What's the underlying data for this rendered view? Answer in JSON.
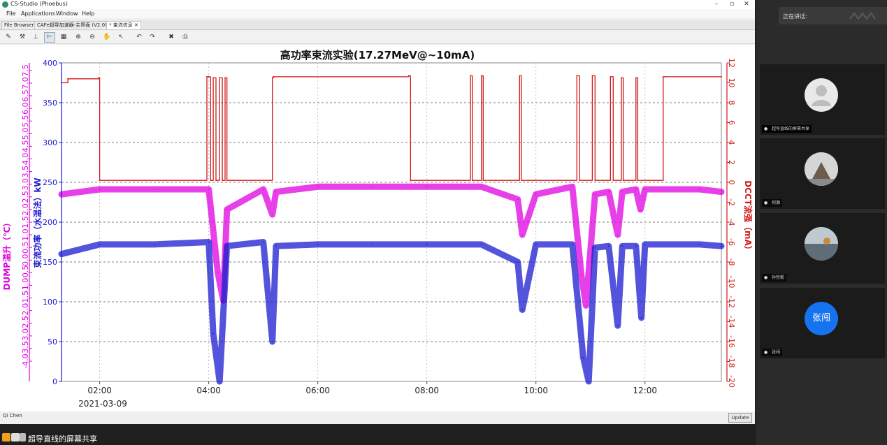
{
  "window": {
    "title": "CS-Studio (Phoebus)"
  },
  "menu": [
    "File",
    "Applications",
    "Window",
    "Help"
  ],
  "tabs": [
    {
      "label": "File Browser",
      "active": false
    },
    {
      "label": "CAFe超导加速器-主界面 (V2.0)",
      "active": false
    },
    {
      "label": "* 束流信息 ✕",
      "active": true
    }
  ],
  "toolbar_icons": [
    "tool-icon",
    "tool-icon",
    "tool-icon",
    "crosshair-icon",
    "axis-icon",
    "zoom-in-icon",
    "zoom-out-icon",
    "pan-icon",
    "pointer-icon",
    "undo-icon",
    "redo-icon",
    "export-icon",
    "print-icon"
  ],
  "chart_data": {
    "type": "line",
    "title": "高功率束流实验(17.27MeV@~10mA)",
    "date_label": "2021-03-09",
    "xlim": [
      "01:18",
      "13:24"
    ],
    "xticks": [
      "02:00",
      "04:00",
      "06:00",
      "08:00",
      "10:00",
      "12:00"
    ],
    "y_axes": [
      {
        "id": "dump",
        "label": "DUMP温升（℃）",
        "color": "#e000e0",
        "ylim": [
          -4.8,
          7.8
        ],
        "ticks": [
          -4.0,
          -3.5,
          -3.0,
          -2.5,
          -2.0,
          -1.5,
          -1.0,
          -0.5,
          0.0,
          0.5,
          1.0,
          1.5,
          2.0,
          2.5,
          3.0,
          3.5,
          4.0,
          4.5,
          5.0,
          5.5,
          6.0,
          6.5,
          7.0,
          7.5
        ]
      },
      {
        "id": "power",
        "label": "束流功率（水温法）kW",
        "color": "#1a1ad0",
        "ylim": [
          0,
          400
        ],
        "ticks": [
          0,
          50,
          100,
          150,
          200,
          250,
          300,
          350,
          400
        ]
      },
      {
        "id": "dcct",
        "label": "DCCT流强（mA）",
        "color": "#d01818",
        "ylim": [
          -20,
          12
        ],
        "ticks": [
          12,
          10,
          8,
          6,
          4,
          2,
          0,
          -2,
          -4,
          -6,
          -8,
          -10,
          -12,
          -14,
          -16,
          -18,
          -20
        ]
      }
    ],
    "series": [
      {
        "axis": "dcct",
        "color": "#d01818",
        "x": [
          "01:18",
          "01:25",
          "01:59",
          "02:00",
          "03:58",
          "04:00",
          "04:02",
          "04:05",
          "04:08",
          "04:12",
          "04:15",
          "04:18",
          "04:20",
          "05:08",
          "05:10",
          "05:11",
          "07:40",
          "07:42",
          "08:48",
          "08:50",
          "09:00",
          "09:02",
          "09:42",
          "09:44",
          "10:45",
          "10:48",
          "11:02",
          "11:05",
          "11:22",
          "11:25",
          "11:34",
          "11:36",
          "11:50",
          "11:52",
          "12:20",
          "12:22",
          "13:24"
        ],
        "values": [
          10.0,
          10.4,
          10.5,
          0.2,
          10.6,
          10.6,
          0.2,
          10.5,
          0.2,
          10.5,
          0.2,
          10.5,
          0.2,
          0.2,
          10.5,
          10.6,
          10.7,
          0.2,
          10.7,
          0.2,
          10.7,
          0.2,
          10.7,
          0.2,
          10.7,
          0.2,
          10.7,
          0.2,
          10.6,
          0.2,
          10.5,
          0.2,
          10.5,
          0.2,
          10.6,
          10.6,
          10.6
        ]
      },
      {
        "axis": "dump",
        "color": "#e000e0",
        "x": [
          "01:18",
          "02:00",
          "03:00",
          "04:00",
          "04:10",
          "04:16",
          "04:20",
          "05:00",
          "05:10",
          "05:14",
          "06:00",
          "07:00",
          "08:00",
          "09:00",
          "09:40",
          "09:45",
          "10:00",
          "10:40",
          "10:50",
          "10:55",
          "11:05",
          "11:20",
          "11:30",
          "11:35",
          "11:50",
          "11:55",
          "12:00",
          "13:00",
          "13:24"
        ],
        "values": [
          2.6,
          2.8,
          2.8,
          2.8,
          -0.5,
          -1.6,
          2.0,
          2.8,
          1.8,
          2.7,
          2.9,
          2.9,
          2.9,
          2.9,
          2.4,
          1.0,
          2.6,
          2.9,
          -0.6,
          -1.8,
          2.6,
          2.7,
          1.0,
          2.7,
          2.8,
          2.0,
          2.8,
          2.8,
          2.7
        ]
      },
      {
        "axis": "power",
        "color": "#1a1ad0",
        "x": [
          "01:18",
          "02:00",
          "03:00",
          "04:00",
          "04:05",
          "04:12",
          "04:20",
          "05:00",
          "05:10",
          "05:14",
          "06:00",
          "07:00",
          "08:00",
          "09:00",
          "09:40",
          "09:45",
          "10:00",
          "10:40",
          "10:52",
          "10:58",
          "11:05",
          "11:20",
          "11:30",
          "11:35",
          "11:50",
          "11:56",
          "12:00",
          "13:00",
          "13:24"
        ],
        "values": [
          160,
          172,
          172,
          175,
          60,
          0,
          170,
          175,
          50,
          170,
          172,
          172,
          172,
          172,
          150,
          90,
          172,
          172,
          30,
          0,
          168,
          170,
          70,
          170,
          170,
          80,
          172,
          172,
          170
        ]
      }
    ]
  },
  "status": {
    "user": "Qi Chen",
    "update_label": "Update"
  },
  "share_bar": {
    "text": "超导直线的屏幕共享"
  },
  "meeting": {
    "header": "正在讲话:",
    "participants": [
      {
        "name": "超导直线的屏幕共享",
        "avatar": "default-avatar"
      },
      {
        "name": "何源",
        "avatar": "photo-avatar"
      },
      {
        "name": "孙哲毅",
        "avatar": "photo-avatar"
      },
      {
        "name": "张闯",
        "avatar_text": "张闯"
      }
    ]
  }
}
